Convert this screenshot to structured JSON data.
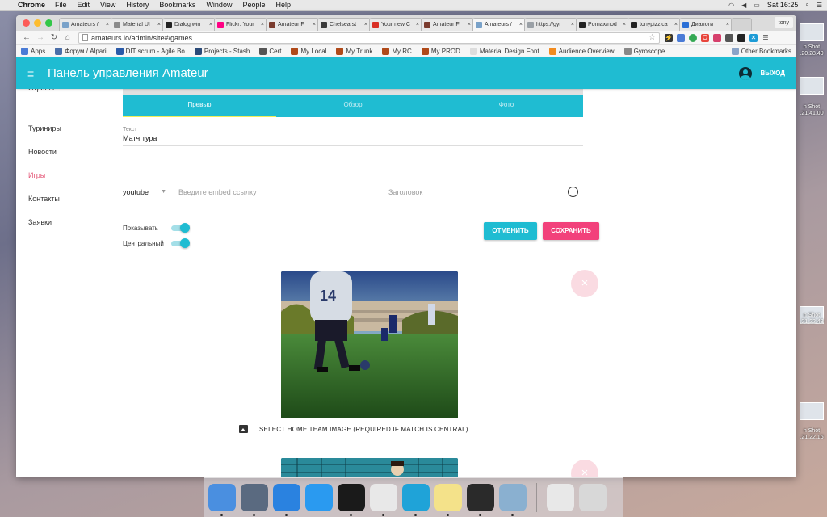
{
  "menubar": {
    "app_name": "Chrome",
    "items": [
      "File",
      "Edit",
      "View",
      "History",
      "Bookmarks",
      "Window",
      "People",
      "Help"
    ],
    "clock": "Sat 16:25"
  },
  "browser": {
    "tabs": [
      {
        "label": "Amateurs /",
        "color": "#7aa2c9"
      },
      {
        "label": "Material UI",
        "color": "#8a8a8a"
      },
      {
        "label": "Dialog win",
        "color": "#222222"
      },
      {
        "label": "Flickr: Your",
        "color": "#ff0084"
      },
      {
        "label": "Amateur F",
        "color": "#7a3b2e"
      },
      {
        "label": "Chelsea st",
        "color": "#3a3a3a"
      },
      {
        "label": "Your new C",
        "color": "#d93025"
      },
      {
        "label": "Amateur F",
        "color": "#7a3b2e"
      },
      {
        "label": "Amateurs /",
        "color": "#7aa2c9",
        "active": true
      },
      {
        "label": "https://gyr",
        "color": "#9aa0a6"
      },
      {
        "label": "Pornax/nod",
        "color": "#222222"
      },
      {
        "label": "tonypizzica",
        "color": "#222222"
      },
      {
        "label": "Диалоги",
        "color": "#2a6fd6"
      }
    ],
    "profile": "tony",
    "url": "amateurs.io/admin/site#/games",
    "bookmarks": [
      {
        "label": "Apps",
        "color": "#4a7bd6"
      },
      {
        "label": "Форум / Alpari",
        "color": "#4a6ea8"
      },
      {
        "label": "DIT scrum - Agile Bo",
        "color": "#2a5aa8"
      },
      {
        "label": "Projects - Stash",
        "color": "#2b4a78"
      },
      {
        "label": "Cert",
        "color": "#555555"
      },
      {
        "label": "My Local",
        "color": "#b04a1a"
      },
      {
        "label": "My Trunk",
        "color": "#b04a1a"
      },
      {
        "label": "My RC",
        "color": "#b04a1a"
      },
      {
        "label": "My PROD",
        "color": "#b04a1a"
      },
      {
        "label": "Material Design Font",
        "color": "#dddddd"
      },
      {
        "label": "Audience Overview",
        "color": "#f28b1f"
      },
      {
        "label": "Gyroscope",
        "color": "#888888"
      }
    ],
    "other_bookmarks": "Other Bookmarks"
  },
  "app": {
    "title": "Панель управления Amateur",
    "logout_label": "ВЫХОД",
    "accent_color": "#1fbcd2",
    "sidebar": [
      {
        "label": "Страны"
      },
      {
        "label": "Туриниры"
      },
      {
        "label": "Новости"
      },
      {
        "label": "Игры",
        "active": true
      },
      {
        "label": "Контакты"
      },
      {
        "label": "Заявки"
      }
    ],
    "content_tabs": [
      {
        "label": "Превью",
        "active": true
      },
      {
        "label": "Обзор"
      },
      {
        "label": "Фото"
      }
    ],
    "text_field": {
      "label": "Текст",
      "value": "Матч тура"
    },
    "source_select": {
      "value": "youtube"
    },
    "embed_input": {
      "placeholder": "Введите embed ссылку"
    },
    "title_input": {
      "placeholder": "Заголовок"
    },
    "toggles": [
      {
        "label": "Показывать",
        "on": true
      },
      {
        "label": "Центральный",
        "on": true
      }
    ],
    "cancel_label": "ОТМЕНИТЬ",
    "save_label": "СОХРАНИТЬ",
    "home_image_label": "SELECT HOME TEAM IMAGE (REQUIRED IF MATCH IS CENTRAL)",
    "close_glyph": "×"
  },
  "desktop_labels": [
    {
      "text": "n Shot\n.20.28.49"
    },
    {
      "text": "n Shot\n.21.41.00"
    },
    {
      "text": "n Shot\n.21.22.43"
    },
    {
      "text": "n Shot\n.21.22.16"
    }
  ],
  "dock": [
    {
      "name": "finder",
      "color": "#4a8fe0"
    },
    {
      "name": "launchpad",
      "color": "#5a6a80"
    },
    {
      "name": "safari",
      "color": "#2a82e0"
    },
    {
      "name": "app-store",
      "color": "#2a9af0"
    },
    {
      "name": "terminal",
      "color": "#1a1a1a"
    },
    {
      "name": "chrome",
      "color": "#e8e8e8"
    },
    {
      "name": "webstorm",
      "color": "#1fa3d8"
    },
    {
      "name": "notes",
      "color": "#f4e28a"
    },
    {
      "name": "activity-monitor",
      "color": "#2a2a2a"
    },
    {
      "name": "preview",
      "color": "#8ab0d0"
    },
    {
      "name": "downloads",
      "color": "#e8e8e8"
    },
    {
      "name": "trash",
      "color": "#d8d8d8"
    }
  ]
}
